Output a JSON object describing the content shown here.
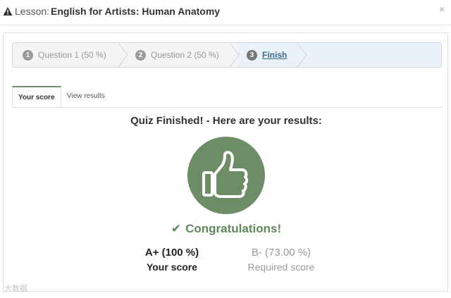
{
  "header": {
    "title_prefix": "Lesson:",
    "title": "English for Artists: Human Anatomy",
    "close_label": "×",
    "icon": "warning-icon"
  },
  "wizard": {
    "steps": [
      {
        "number": "1",
        "label": "Question 1 (50 %)",
        "state": "completed"
      },
      {
        "number": "2",
        "label": "Question 2 (50 %)",
        "state": "completed"
      },
      {
        "number": "3",
        "label": "Finish",
        "state": "active"
      }
    ]
  },
  "tabs": [
    {
      "label": "Your score",
      "active": true
    },
    {
      "label": "View results",
      "active": false
    }
  ],
  "result": {
    "heading": "Quiz Finished! - Here are your results:",
    "badge_icon": "thumbs-up-icon",
    "congrats": "Congratulations!",
    "your_score_value": "A+ (100 %)",
    "your_score_label": "Your score",
    "required_score_value": "B- (73.00 %)",
    "required_score_label": "Required score"
  },
  "watermark": "大数据",
  "colors": {
    "accent_green": "#6d8d67",
    "link_blue": "#3a6a8c"
  }
}
